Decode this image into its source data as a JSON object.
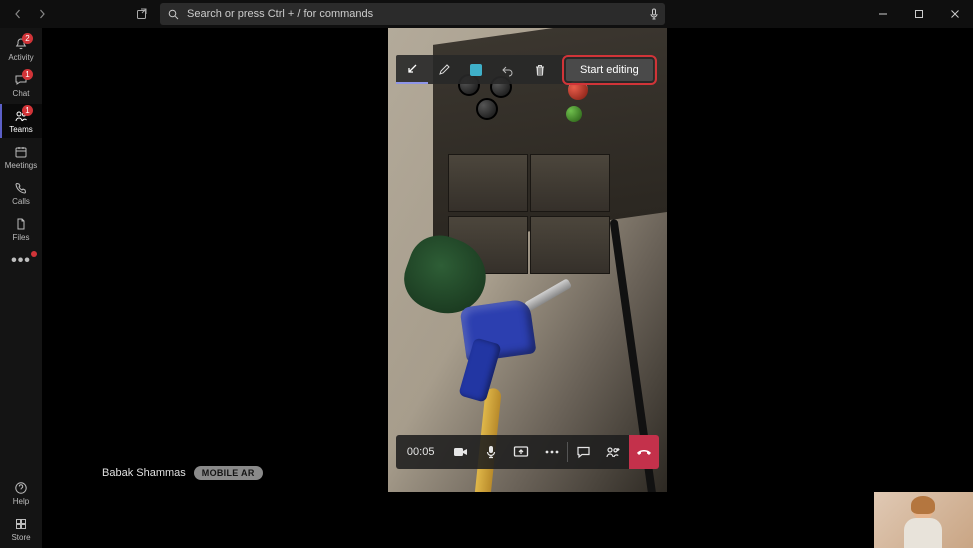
{
  "search": {
    "placeholder": "Search or press Ctrl + / for commands"
  },
  "rail": {
    "items": [
      {
        "label": "Activity",
        "badge": "2"
      },
      {
        "label": "Chat",
        "badge": "1"
      },
      {
        "label": "Teams",
        "badge": "1"
      },
      {
        "label": "Meetings"
      },
      {
        "label": "Calls"
      },
      {
        "label": "Files"
      }
    ],
    "help": "Help",
    "store": "Store"
  },
  "participant": {
    "name": "Babak Shammas",
    "tag": "MOBILE AR"
  },
  "annotate": {
    "start": "Start editing"
  },
  "call": {
    "duration": "00:05"
  }
}
